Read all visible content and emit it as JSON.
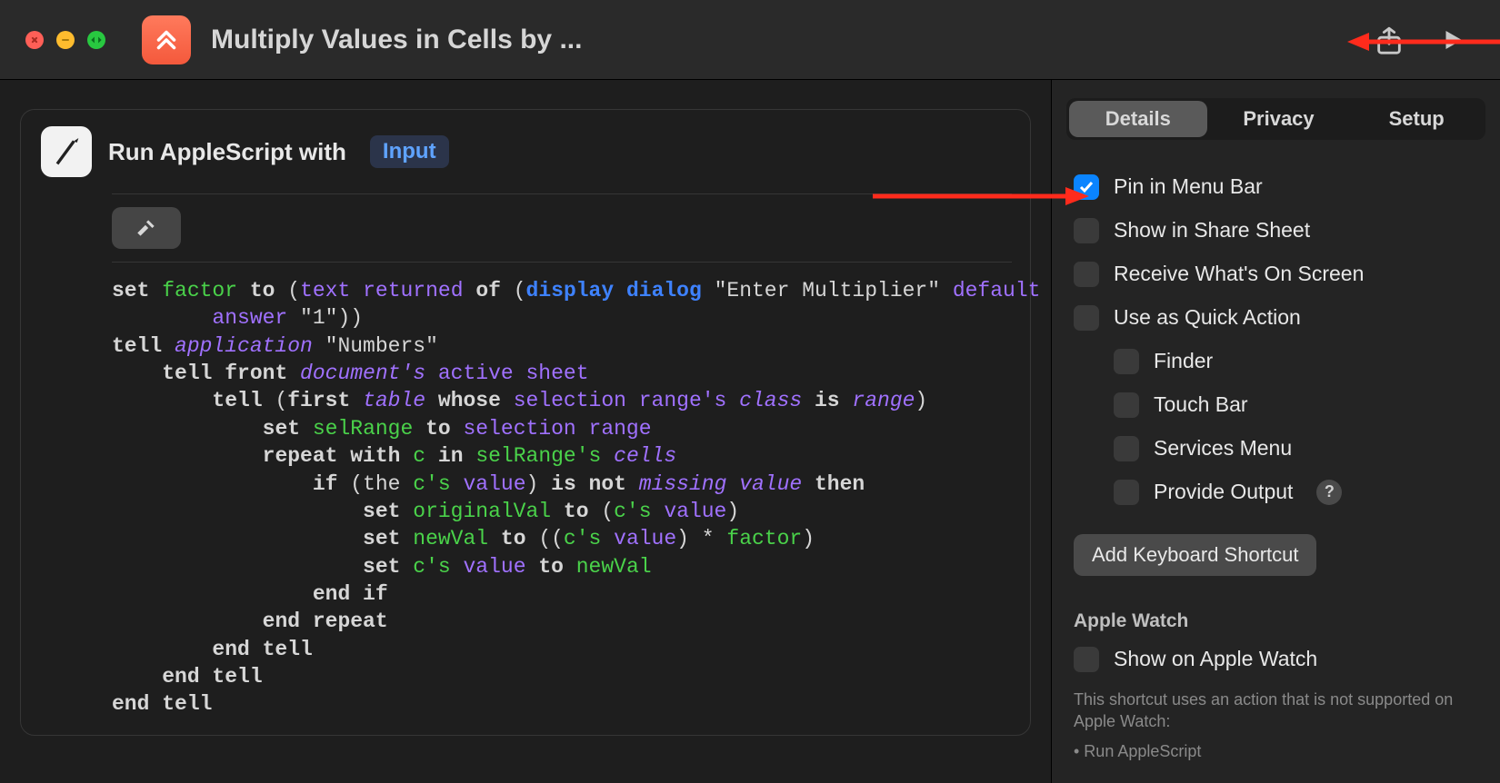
{
  "window": {
    "title": "Multiply Values in Cells by ..."
  },
  "action": {
    "title": "Run AppleScript with",
    "input_token": "Input"
  },
  "code": {
    "l1a": "set ",
    "l1b": "factor",
    "l1c": " to ",
    "l1d": "(",
    "l1e": "text returned",
    "l1f": " of ",
    "l1g": "(",
    "l1h": "display dialog",
    "l1i": " \"Enter Multiplier\" ",
    "l1j": "default",
    "l2a": "answer",
    "l2b": " \"1\"))",
    "l3a": "tell ",
    "l3b": "application",
    "l3c": " \"Numbers\"",
    "l4a": "tell front ",
    "l4b": "document's",
    "l4c": " active sheet",
    "l5a": "tell ",
    "l5b": "(",
    "l5c": "first ",
    "l5d": "table",
    "l5e": " whose ",
    "l5f": "selection range's",
    "l5g": " class",
    "l5h": " is ",
    "l5i": "range",
    "l5j": ")",
    "l6a": "set ",
    "l6b": "selRange",
    "l6c": " to ",
    "l6d": "selection range",
    "l7a": "repeat with ",
    "l7b": "c",
    "l7c": " in ",
    "l7d": "selRange's",
    "l7e": " cells",
    "l8a": "if ",
    "l8b": "(the ",
    "l8c": "c's",
    "l8d": " value",
    "l8e": ")",
    "l8f": " is not ",
    "l8g": "missing value",
    "l8h": " then",
    "l9a": "set ",
    "l9b": "originalVal",
    "l9c": " to ",
    "l9d": "(",
    "l9e": "c's",
    "l9f": " value",
    "l9g": ")",
    "l10a": "set ",
    "l10b": "newVal",
    "l10c": " to ",
    "l10d": "((",
    "l10e": "c's",
    "l10f": " value",
    "l10g": ") * ",
    "l10h": "factor",
    "l10i": ")",
    "l11a": "set ",
    "l11b": "c's",
    "l11c": " value",
    "l11d": " to ",
    "l11e": "newVal",
    "l12": "end if",
    "l13": "end repeat",
    "l14": "end tell",
    "l15": "end tell",
    "l16": "end tell"
  },
  "inspector": {
    "tabs": {
      "details": "Details",
      "privacy": "Privacy",
      "setup": "Setup"
    },
    "checks": {
      "pin": "Pin in Menu Bar",
      "share": "Show in Share Sheet",
      "receive": "Receive What's On Screen",
      "quick": "Use as Quick Action",
      "finder": "Finder",
      "touchbar": "Touch Bar",
      "services": "Services Menu",
      "provide": "Provide Output"
    },
    "shortcut_btn": "Add Keyboard Shortcut",
    "watch_section": "Apple Watch",
    "watch_check": "Show on Apple Watch",
    "watch_desc1": "This shortcut uses an action that is not supported on Apple Watch:",
    "watch_desc2": "• Run AppleScript",
    "help": "?"
  }
}
